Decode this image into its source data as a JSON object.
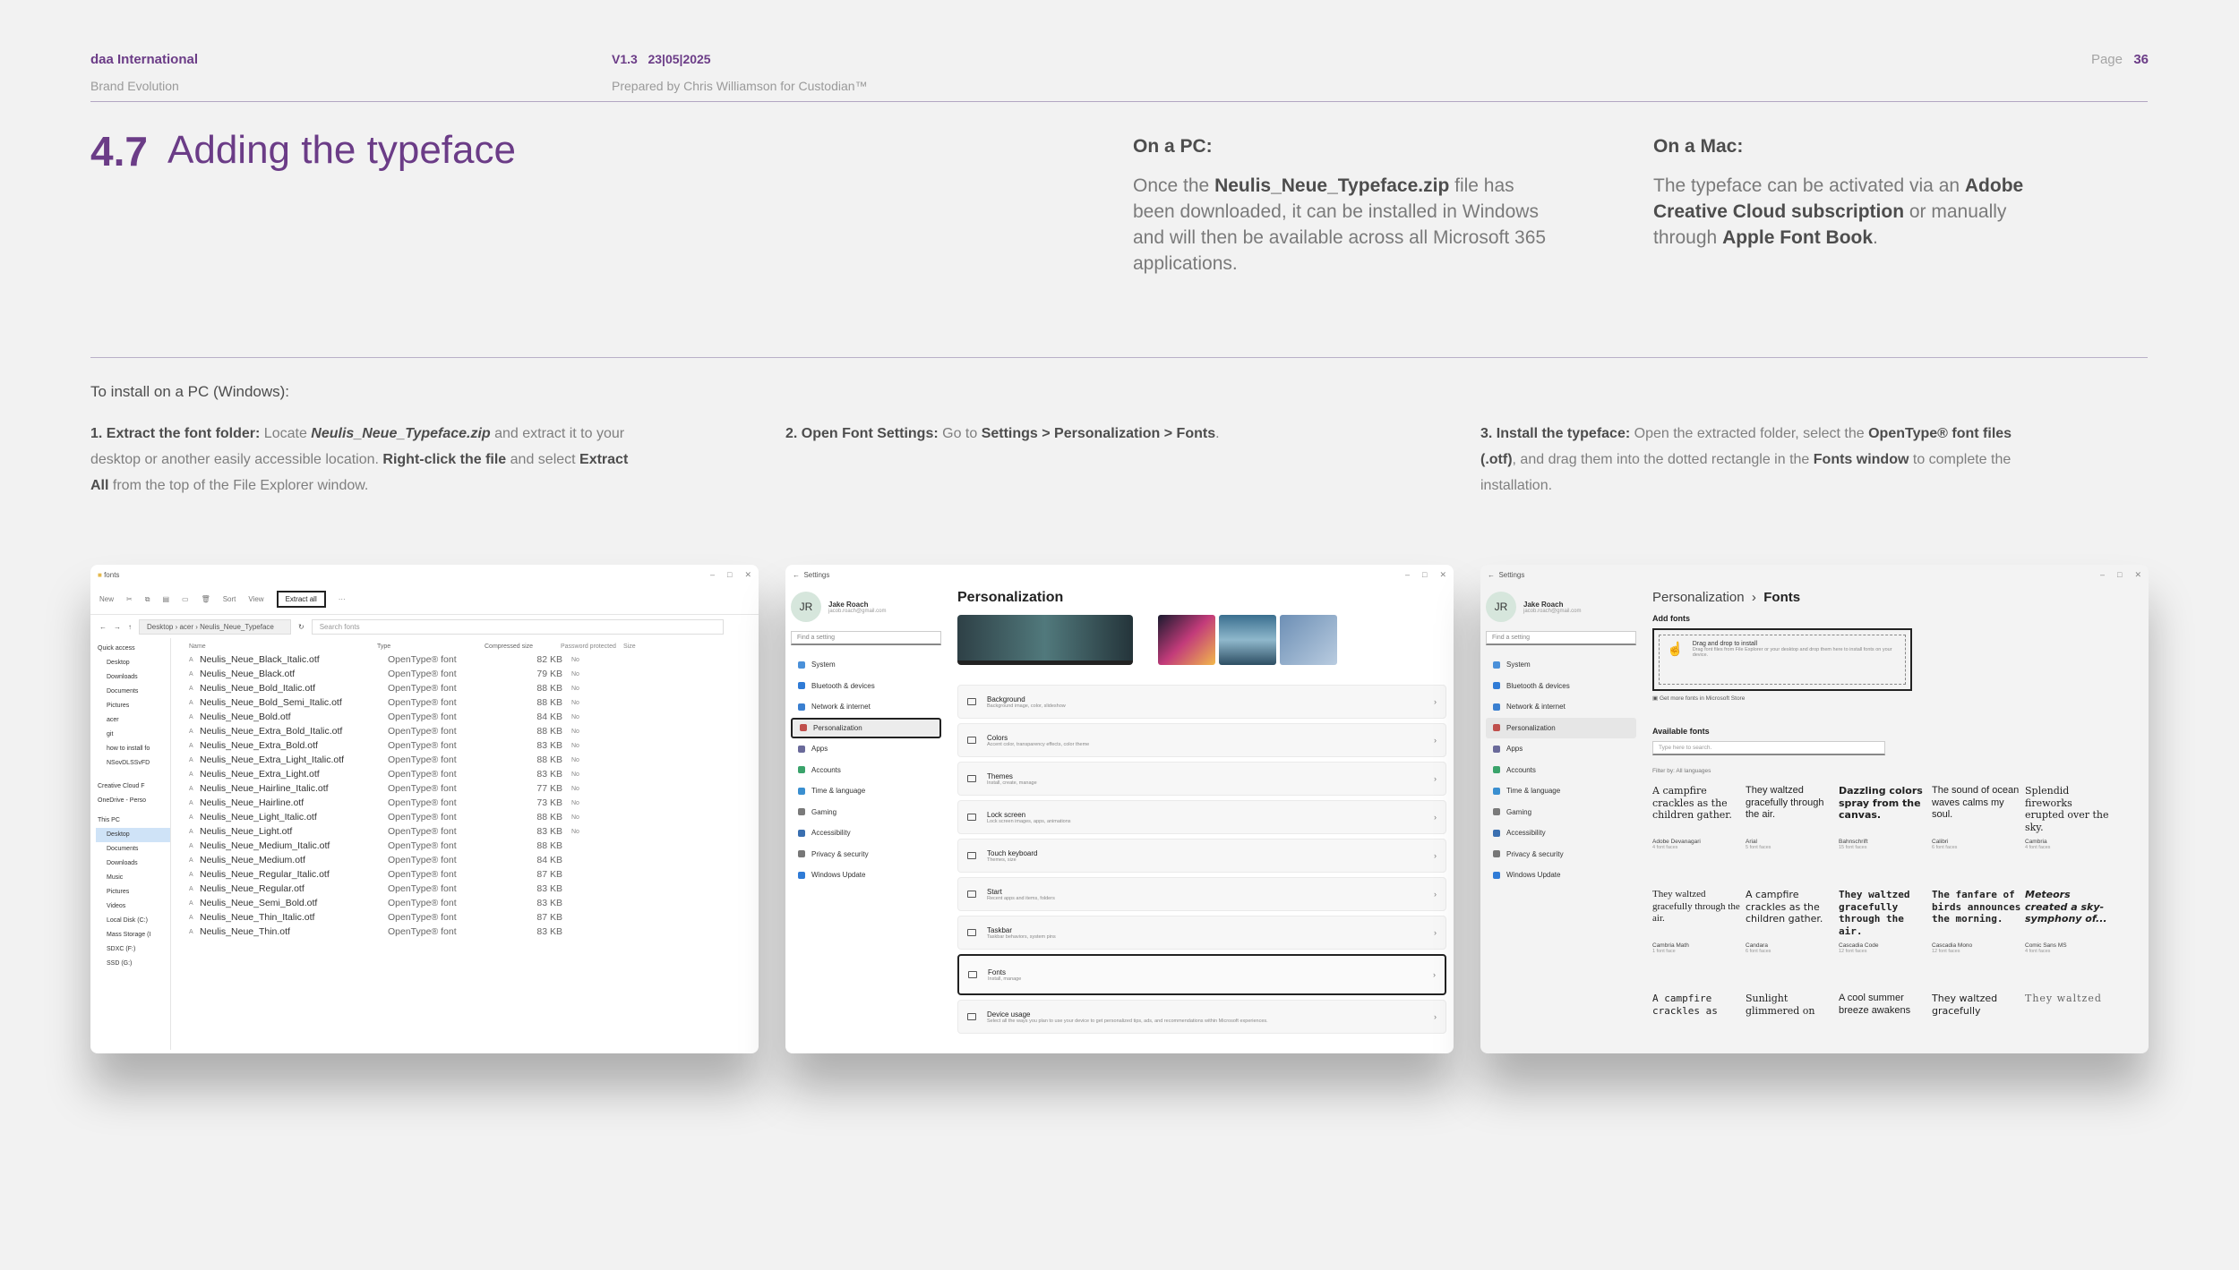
{
  "header": {
    "brand": "daa International",
    "subbrand": "Brand Evolution",
    "version": "V1.3   23|05|2025",
    "prepared": "Prepared by Chris Williamson for Custodian™",
    "page_label": "Page",
    "page_number": "36"
  },
  "section": {
    "number": "4.7",
    "title": "Adding the typeface"
  },
  "pc": {
    "heading": "On a PC:",
    "text_1": "Once the ",
    "bold_1": "Neulis_Neue_Typeface.zip",
    "text_2": " file has been downloaded, it can be installed in Windows and will then be available across all Microsoft 365 applications."
  },
  "mac": {
    "heading": "On a Mac:",
    "text_1": "The typeface can be activated via an ",
    "bold_1": "Adobe Creative Cloud subscription",
    "text_2": " or manually through ",
    "bold_2": "Apple Font Book",
    "text_3": "."
  },
  "install": {
    "heading": "To install on a PC (Windows):",
    "step1": {
      "b1": "1. Extract the font folder:",
      "t1": " Locate ",
      "b2": "Neulis_Neue_Typeface.zip",
      "t2": " and extract it to your desktop or another easily accessible location. ",
      "b3": "Right-click the file",
      "t3": " and select ",
      "b4": "Extract All",
      "t4": " from the top of the File Explorer window."
    },
    "step2": {
      "b1": "2. Open Font Settings:",
      "t1": " Go to ",
      "b2": "Settings > Personalization > Fonts",
      "t2": "."
    },
    "step3": {
      "b1": "3. Install the typeface:",
      "t1": " Open the extracted folder, select the ",
      "b2": "OpenType® font files (.otf)",
      "t2": ", and drag them into the dotted rectangle in the ",
      "b3": "Fonts window",
      "t3": " to complete the installation."
    }
  },
  "explorer": {
    "title": "fonts",
    "toolbar": {
      "new": "New",
      "sort": "Sort",
      "view": "View",
      "extract_all": "Extract all"
    },
    "address": "Desktop  ›  acer  ›  Neulis_Neue_Typeface",
    "search_placeholder": "Search fonts",
    "columns": {
      "name": "Name",
      "type": "Type",
      "compressed": "Compressed size",
      "password": "Password protected",
      "size": "Size"
    },
    "sidebar": [
      "Quick access",
      "Desktop",
      "Downloads",
      "Documents",
      "Pictures",
      "acer",
      "git",
      "how to install fo",
      "NSovDLSSvFD",
      "Creative Cloud F",
      "OneDrive - Perso",
      "This PC",
      "Desktop",
      "Documents",
      "Downloads",
      "Music",
      "Pictures",
      "Videos",
      "Local Disk (C:)",
      "Mass Storage (I",
      "SDXC (F:)",
      "SSD (G:)"
    ],
    "files": [
      {
        "name": "Neulis_Neue_Black_Italic.otf",
        "type": "OpenType® font",
        "size": "82 KB",
        "pw": "No"
      },
      {
        "name": "Neulis_Neue_Black.otf",
        "type": "OpenType® font",
        "size": "79 KB",
        "pw": "No"
      },
      {
        "name": "Neulis_Neue_Bold_Italic.otf",
        "type": "OpenType® font",
        "size": "88 KB",
        "pw": "No"
      },
      {
        "name": "Neulis_Neue_Bold_Semi_Italic.otf",
        "type": "OpenType® font",
        "size": "88 KB",
        "pw": "No"
      },
      {
        "name": "Neulis_Neue_Bold.otf",
        "type": "OpenType® font",
        "size": "84 KB",
        "pw": "No"
      },
      {
        "name": "Neulis_Neue_Extra_Bold_Italic.otf",
        "type": "OpenType® font",
        "size": "88 KB",
        "pw": "No"
      },
      {
        "name": "Neulis_Neue_Extra_Bold.otf",
        "type": "OpenType® font",
        "size": "83 KB",
        "pw": "No"
      },
      {
        "name": "Neulis_Neue_Extra_Light_Italic.otf",
        "type": "OpenType® font",
        "size": "88 KB",
        "pw": "No"
      },
      {
        "name": "Neulis_Neue_Extra_Light.otf",
        "type": "OpenType® font",
        "size": "83 KB",
        "pw": "No"
      },
      {
        "name": "Neulis_Neue_Hairline_Italic.otf",
        "type": "OpenType® font",
        "size": "77 KB",
        "pw": "No"
      },
      {
        "name": "Neulis_Neue_Hairline.otf",
        "type": "OpenType® font",
        "size": "73 KB",
        "pw": "No"
      },
      {
        "name": "Neulis_Neue_Light_Italic.otf",
        "type": "OpenType® font",
        "size": "88 KB",
        "pw": "No"
      },
      {
        "name": "Neulis_Neue_Light.otf",
        "type": "OpenType® font",
        "size": "83 KB",
        "pw": "No"
      },
      {
        "name": "Neulis_Neue_Medium_Italic.otf",
        "type": "OpenType® font",
        "size": "88 KB",
        "pw": ""
      },
      {
        "name": "Neulis_Neue_Medium.otf",
        "type": "OpenType® font",
        "size": "84 KB",
        "pw": ""
      },
      {
        "name": "Neulis_Neue_Regular_Italic.otf",
        "type": "OpenType® font",
        "size": "87 KB",
        "pw": ""
      },
      {
        "name": "Neulis_Neue_Regular.otf",
        "type": "OpenType® font",
        "size": "83 KB",
        "pw": ""
      },
      {
        "name": "Neulis_Neue_Semi_Bold.otf",
        "type": "OpenType® font",
        "size": "83 KB",
        "pw": ""
      },
      {
        "name": "Neulis_Neue_Thin_Italic.otf",
        "type": "OpenType® font",
        "size": "87 KB",
        "pw": ""
      },
      {
        "name": "Neulis_Neue_Thin.otf",
        "type": "OpenType® font",
        "size": "83 KB",
        "pw": ""
      }
    ]
  },
  "settings": {
    "title": "Settings",
    "user_initials": "JR",
    "user_name": "Jake Roach",
    "user_email": "jacob.roach@gmail.com",
    "find_placeholder": "Find a setting",
    "nav": [
      "System",
      "Bluetooth & devices",
      "Network & internet",
      "Personalization",
      "Apps",
      "Accounts",
      "Time & language",
      "Gaming",
      "Accessibility",
      "Privacy & security",
      "Windows Update"
    ],
    "page_title": "Personalization",
    "cards": [
      {
        "t": "Background",
        "s": "Background image, color, slideshow"
      },
      {
        "t": "Colors",
        "s": "Accent color, transparency effects, color theme"
      },
      {
        "t": "Themes",
        "s": "Install, create, manage"
      },
      {
        "t": "Lock screen",
        "s": "Lock screen images, apps, animations"
      },
      {
        "t": "Touch keyboard",
        "s": "Themes, size"
      },
      {
        "t": "Start",
        "s": "Recent apps and items, folders"
      },
      {
        "t": "Taskbar",
        "s": "Taskbar behaviors, system pins"
      },
      {
        "t": "Fonts",
        "s": "Install, manage"
      },
      {
        "t": "Device usage",
        "s": "Select all the ways you plan to use your device to get personalized tips, ads, and recommendations within Microsoft experiences."
      }
    ]
  },
  "fonts_window": {
    "crumb_1": "Personalization",
    "crumb_sep": "›",
    "crumb_2": "Fonts",
    "add_fonts": "Add fonts",
    "drop_title": "Drag and drop to install",
    "drop_sub": "Drag font files from File Explorer or your desktop and drop them here to install fonts on your device.",
    "store_link": "Get more fonts in Microsoft Store",
    "available": "Available fonts",
    "search_placeholder": "Type here to search.",
    "filter": "Filter by: All languages",
    "fonts": [
      {
        "sample": "A campfire crackles as the children gather.",
        "name": "Adobe Devanagari",
        "faces": "4 font faces"
      },
      {
        "sample": "They waltzed gracefully through the air.",
        "name": "Arial",
        "faces": "5 font faces"
      },
      {
        "sample": "Dazzling colors spray from the canvas.",
        "name": "Bahnschrift",
        "faces": "15 font faces"
      },
      {
        "sample": "The sound of ocean waves calms my soul.",
        "name": "Calibri",
        "faces": "6 font faces"
      },
      {
        "sample": "Splendid fireworks erupted over the sky.",
        "name": "Cambria",
        "faces": "4 font faces"
      },
      {
        "sample": "They waltzed gracefully through the air.",
        "name": "Cambria Math",
        "faces": "1 font face"
      },
      {
        "sample": "A campfire crackles as the children gather.",
        "name": "Candara",
        "faces": "6 font faces"
      },
      {
        "sample": "They waltzed gracefully through the air.",
        "name": "Cascadia Code",
        "faces": "12 font faces"
      },
      {
        "sample": "The fanfare of birds announces the morning.",
        "name": "Cascadia Mono",
        "faces": "12 font faces"
      },
      {
        "sample": "Meteors created a sky-symphony of...",
        "name": "Comic Sans MS",
        "faces": "4 font faces"
      },
      {
        "sample": "A campfire crackles as",
        "name": "",
        "faces": ""
      },
      {
        "sample": "Sunlight glimmered on",
        "name": "",
        "faces": ""
      },
      {
        "sample": "A cool summer breeze awakens",
        "name": "",
        "faces": ""
      },
      {
        "sample": "They waltzed gracefully",
        "name": "",
        "faces": ""
      },
      {
        "sample": "They waltzed",
        "name": "",
        "faces": ""
      }
    ]
  }
}
